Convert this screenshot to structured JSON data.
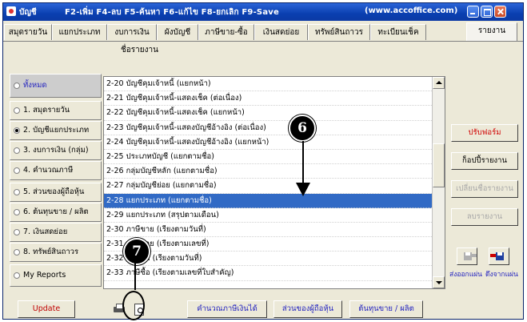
{
  "window": {
    "title": "บัญชี",
    "shortcuts": "F2-เพิ่ม  F4-ลบ  F5-ค้นหา  F6-แก้ไข  F8-ยกเลิก  F9-Save",
    "url": "(www.accoffice.com)"
  },
  "tabs": [
    "สมุดรายวัน",
    "แยกประเภท",
    "งบการเงิน",
    "ผังบัญชี",
    "ภาษีขาย-ซื้อ",
    "เงินสดย่อย",
    "ทรัพย์สินถาวร",
    "ทะเบียนเช็ค",
    "รายงาน"
  ],
  "list_header": "ชื่อรายงาน",
  "categories": [
    {
      "label": "ทั้งหมด",
      "selected": false
    },
    {
      "label": "1. สมุดรายวัน",
      "selected": false
    },
    {
      "label": "2. บัญชีแยกประเภท",
      "selected": true
    },
    {
      "label": "3. งบการเงิน (กลุ่ม)",
      "selected": false
    },
    {
      "label": "4. คำนวณภาษี",
      "selected": false
    },
    {
      "label": "5. ส่วนของผู้ถือหุ้น",
      "selected": false
    },
    {
      "label": "6. ต้นทุนขาย / ผลิต",
      "selected": false
    },
    {
      "label": "7. เงินสดย่อย",
      "selected": false
    },
    {
      "label": "8. ทรัพย์สินถาวร",
      "selected": false
    },
    {
      "label": "My Reports",
      "selected": false
    }
  ],
  "reports": [
    "2-20 บัญชีคุมเจ้าหนี้ (แยกหน้า)",
    "2-21 บัญชีคุมเจ้าหนี้-แสดงเช็ค (ต่อเนื่อง)",
    "2-22 บัญชีคุมเจ้าหนี้-แสดงเช็ค (แยกหน้า)",
    "2-23 บัญชีคุมเจ้าหนี้-แสดงบัญชีอ้างอิง (ต่อเนื่อง)",
    "2-24 บัญชีคุมเจ้าหนี้-แสดงบัญชีอ้างอิง (แยกหน้า)",
    "2-25 ประเภทบัญชี (แยกตามชื่อ)",
    "2-26 กลุ่มบัญชีหลัก (แยกตามชื่อ)",
    "2-27 กลุ่มบัญชีย่อย (แยกตามชื่อ)",
    "2-28 แยกประเภท (แยกตามชื่อ)",
    "2-29 แยกประเภท (สรุปตามเดือน)",
    "2-30 ภาษีขาย (เรียงตามวันที่)",
    "2-31 ภาษีขาย (เรียงตามเลขที่)",
    "2-32 ภาษีซื้อ (เรียงตามวันที่)",
    "2-33 ภาษีซื้อ (เรียงตามเลขที่ใบสำคัญ)"
  ],
  "selected_report_index": 8,
  "right_buttons": {
    "customize_form": "ปรับฟอร์ม",
    "save_as": "ก็อปปี้รายงาน",
    "rename": "เปลี่ยนชื่อรายงาน",
    "delete": "ลบรายงาน"
  },
  "icon_labels": {
    "send": "ส่งออกแผ่น",
    "receive": "ดึงจากแผ่น"
  },
  "bottom_buttons": {
    "update": "Update",
    "tax_calc": "คำนวณภาษีเงินได้นิติบุคคล",
    "equity": "ส่วนของผู้ถือหุ้น",
    "cost": "ต้นทุนขาย / ผลิต"
  },
  "callouts": [
    "6",
    "7"
  ],
  "icons": [
    "app-icon",
    "printer-icon",
    "print-preview-icon",
    "floppy-send-icon",
    "floppy-receive-icon"
  ]
}
